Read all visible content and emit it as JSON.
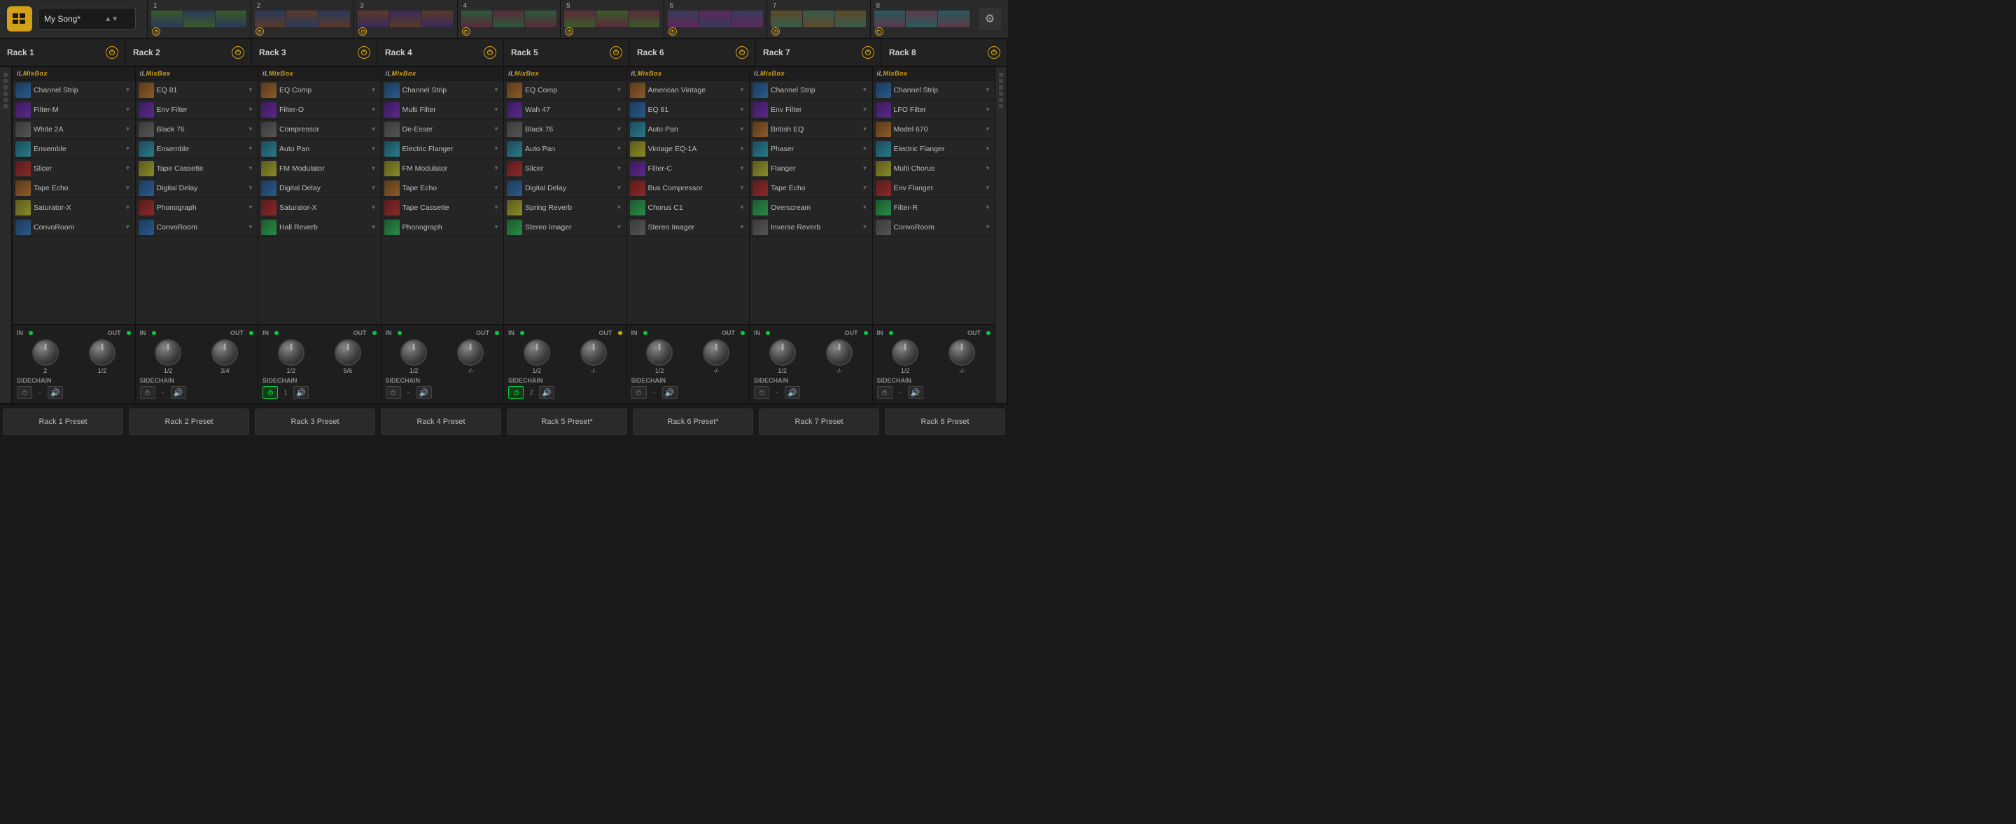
{
  "app": {
    "logo": "M",
    "song_name": "My Song*",
    "settings_icon": "⚙"
  },
  "rack_tabs": [
    {
      "num": "1",
      "power_color": "#d4a017"
    },
    {
      "num": "2",
      "power_color": "#d4a017"
    },
    {
      "num": "3",
      "power_color": "#d4a017"
    },
    {
      "num": "4",
      "power_color": "#d4a017"
    },
    {
      "num": "5",
      "power_color": "#d4a017"
    },
    {
      "num": "6",
      "power_color": "#d4a017"
    },
    {
      "num": "7",
      "power_color": "#d4a017"
    },
    {
      "num": "8",
      "power_color": "#d4a017"
    }
  ],
  "racks": [
    {
      "id": 1,
      "name": "Rack 1",
      "plugins": [
        {
          "name": "Channel Strip",
          "color": "pt-blue"
        },
        {
          "name": "Filter-M",
          "color": "pt-purple"
        },
        {
          "name": "White 2A",
          "color": "pt-gray"
        },
        {
          "name": "Ensemble",
          "color": "pt-teal"
        },
        {
          "name": "Slicer",
          "color": "pt-red"
        },
        {
          "name": "Tape Echo",
          "color": "pt-orange"
        },
        {
          "name": "Saturator-X",
          "color": "pt-yellow"
        },
        {
          "name": "ConvoRoom",
          "color": "pt-blue"
        }
      ],
      "in_val": "2",
      "out_val": "1/2",
      "sidechain_val": "-",
      "sc_active": false
    },
    {
      "id": 2,
      "name": "Rack 2",
      "plugins": [
        {
          "name": "EQ 81",
          "color": "pt-orange"
        },
        {
          "name": "Env Filter",
          "color": "pt-purple"
        },
        {
          "name": "Black 76",
          "color": "pt-gray"
        },
        {
          "name": "Ensemble",
          "color": "pt-teal"
        },
        {
          "name": "Tape Cassette",
          "color": "pt-yellow"
        },
        {
          "name": "Digital Delay",
          "color": "pt-blue"
        },
        {
          "name": "Phonograph",
          "color": "pt-red"
        },
        {
          "name": "ConvoRoom",
          "color": "pt-blue"
        }
      ],
      "in_val": "1/2",
      "out_val": "3/4",
      "sidechain_val": "-",
      "sc_active": false
    },
    {
      "id": 3,
      "name": "Rack 3",
      "plugins": [
        {
          "name": "EQ Comp",
          "color": "pt-orange"
        },
        {
          "name": "Filter-O",
          "color": "pt-purple"
        },
        {
          "name": "Compressor",
          "color": "pt-gray"
        },
        {
          "name": "Auto Pan",
          "color": "pt-teal"
        },
        {
          "name": "FM Modulator",
          "color": "pt-yellow"
        },
        {
          "name": "Digital Delay",
          "color": "pt-blue"
        },
        {
          "name": "Saturator-X",
          "color": "pt-red"
        },
        {
          "name": "Hall Reverb",
          "color": "pt-green"
        }
      ],
      "in_val": "1/2",
      "out_val": "5/6",
      "sidechain_val": "1",
      "sc_active": true
    },
    {
      "id": 4,
      "name": "Rack 4",
      "plugins": [
        {
          "name": "Channel Strip",
          "color": "pt-blue"
        },
        {
          "name": "Multi Filter",
          "color": "pt-purple"
        },
        {
          "name": "De-Esser",
          "color": "pt-gray"
        },
        {
          "name": "Electric Flanger",
          "color": "pt-teal"
        },
        {
          "name": "FM Modulator",
          "color": "pt-yellow"
        },
        {
          "name": "Tape Echo",
          "color": "pt-orange"
        },
        {
          "name": "Tape Cassette",
          "color": "pt-red"
        },
        {
          "name": "Phonograph",
          "color": "pt-green"
        }
      ],
      "in_val": "1/2",
      "out_val": "-/-",
      "sidechain_val": "-",
      "sc_active": false
    },
    {
      "id": 5,
      "name": "Rack 5",
      "plugins": [
        {
          "name": "EQ Comp",
          "color": "pt-orange"
        },
        {
          "name": "Wah 47",
          "color": "pt-purple"
        },
        {
          "name": "Black 76",
          "color": "pt-gray"
        },
        {
          "name": "Auto Pan",
          "color": "pt-teal"
        },
        {
          "name": "Slicer",
          "color": "pt-red"
        },
        {
          "name": "Digital Delay",
          "color": "pt-blue"
        },
        {
          "name": "Spring Reverb",
          "color": "pt-yellow"
        },
        {
          "name": "Stereo Imager",
          "color": "pt-green"
        }
      ],
      "in_val": "1/2",
      "out_val": "-/-",
      "sidechain_val": "2",
      "sc_active": true
    },
    {
      "id": 6,
      "name": "Rack 6",
      "plugins": [
        {
          "name": "American Vintage",
          "color": "pt-orange"
        },
        {
          "name": "EQ 81",
          "color": "pt-blue"
        },
        {
          "name": "Auto Pan",
          "color": "pt-teal"
        },
        {
          "name": "Vintage EQ-1A",
          "color": "pt-yellow"
        },
        {
          "name": "Filter-C",
          "color": "pt-purple"
        },
        {
          "name": "Bus Compressor",
          "color": "pt-red"
        },
        {
          "name": "Chorus C1",
          "color": "pt-green"
        },
        {
          "name": "Stereo Imager",
          "color": "pt-gray"
        }
      ],
      "in_val": "1/2",
      "out_val": "-/-",
      "sidechain_val": "-",
      "sc_active": false
    },
    {
      "id": 7,
      "name": "Rack 7",
      "plugins": [
        {
          "name": "Channel Strip",
          "color": "pt-blue"
        },
        {
          "name": "Env Filter",
          "color": "pt-purple"
        },
        {
          "name": "British EQ",
          "color": "pt-orange"
        },
        {
          "name": "Phaser",
          "color": "pt-teal"
        },
        {
          "name": "Flanger",
          "color": "pt-yellow"
        },
        {
          "name": "Tape Echo",
          "color": "pt-red"
        },
        {
          "name": "Overscream",
          "color": "pt-green"
        },
        {
          "name": "Inverse Reverb",
          "color": "pt-gray"
        }
      ],
      "in_val": "1/2",
      "out_val": "-/-",
      "sidechain_val": "-",
      "sc_active": false
    },
    {
      "id": 8,
      "name": "Rack 8",
      "plugins": [
        {
          "name": "Channel Strip",
          "color": "pt-blue"
        },
        {
          "name": "LFO Filter",
          "color": "pt-purple"
        },
        {
          "name": "Model 670",
          "color": "pt-orange"
        },
        {
          "name": "Electric Flanger",
          "color": "pt-teal"
        },
        {
          "name": "Multi Chorus",
          "color": "pt-yellow"
        },
        {
          "name": "Env Flanger",
          "color": "pt-red"
        },
        {
          "name": "Filter-R",
          "color": "pt-green"
        },
        {
          "name": "ConvoRoom",
          "color": "pt-gray"
        }
      ],
      "in_val": "1/2",
      "out_val": "-/-",
      "sidechain_val": "-",
      "sc_active": false
    }
  ],
  "presets": [
    {
      "label": "Rack 1 Preset"
    },
    {
      "label": "Rack 2 Preset"
    },
    {
      "label": "Rack 3 Preset"
    },
    {
      "label": "Rack 4 Preset"
    },
    {
      "label": "Rack 5 Preset*"
    },
    {
      "label": "Rack 6 Preset*"
    },
    {
      "label": "Rack 7 Preset"
    },
    {
      "label": "Rack 8 Preset"
    }
  ],
  "io": {
    "in_label": "IN",
    "out_label": "OUT",
    "sidechain_label": "SIDECHAIN"
  }
}
